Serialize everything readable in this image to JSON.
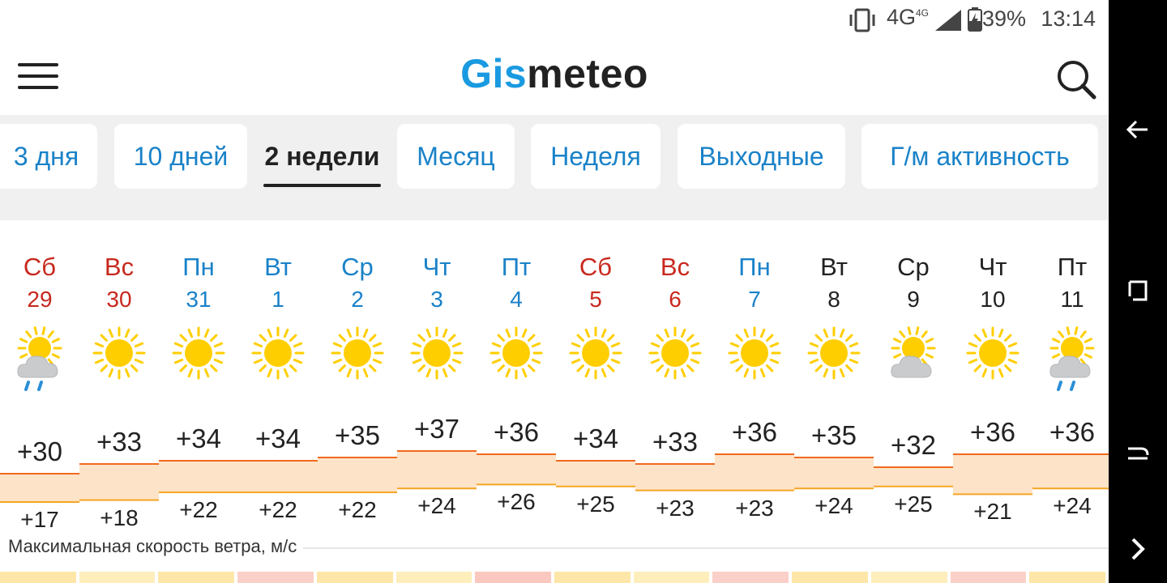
{
  "status": {
    "network": "4G",
    "network_sup": "4G",
    "battery": "39%",
    "time": "13:14"
  },
  "header": {
    "logo_part1": "Gis",
    "logo_part2": "meteo"
  },
  "tabs": [
    {
      "label": "3 дня",
      "active": false
    },
    {
      "label": "10 дней",
      "active": false
    },
    {
      "label": "2 недели",
      "active": true
    },
    {
      "label": "Месяц",
      "active": false
    },
    {
      "label": "Неделя",
      "active": false
    },
    {
      "label": "Выходные",
      "active": false
    },
    {
      "label": "Г/м активность",
      "active": false
    }
  ],
  "days": [
    {
      "dow": "Сб",
      "num": "29",
      "type": "weekend",
      "icon": "partly-cloudy-rain-icon",
      "max": "+30",
      "min": "+17"
    },
    {
      "dow": "Вс",
      "num": "30",
      "type": "weekend",
      "icon": "sun-icon",
      "max": "+33",
      "min": "+18"
    },
    {
      "dow": "Пн",
      "num": "31",
      "type": "weekday",
      "icon": "sun-icon",
      "max": "+34",
      "min": "+22"
    },
    {
      "dow": "Вт",
      "num": "1",
      "type": "weekday",
      "icon": "sun-icon",
      "max": "+34",
      "min": "+22"
    },
    {
      "dow": "Ср",
      "num": "2",
      "type": "weekday",
      "icon": "sun-icon",
      "max": "+35",
      "min": "+22"
    },
    {
      "dow": "Чт",
      "num": "3",
      "type": "weekday",
      "icon": "sun-icon",
      "max": "+37",
      "min": "+24"
    },
    {
      "dow": "Пт",
      "num": "4",
      "type": "weekday",
      "icon": "sun-icon",
      "max": "+36",
      "min": "+26"
    },
    {
      "dow": "Сб",
      "num": "5",
      "type": "weekend",
      "icon": "sun-icon",
      "max": "+34",
      "min": "+25"
    },
    {
      "dow": "Вс",
      "num": "6",
      "type": "weekend",
      "icon": "sun-icon",
      "max": "+33",
      "min": "+23"
    },
    {
      "dow": "Пн",
      "num": "7",
      "type": "weekday",
      "icon": "sun-icon",
      "max": "+36",
      "min": "+23"
    },
    {
      "dow": "Вт",
      "num": "8",
      "type": "normal",
      "icon": "sun-icon",
      "max": "+35",
      "min": "+24"
    },
    {
      "dow": "Ср",
      "num": "9",
      "type": "normal",
      "icon": "partly-cloudy-icon",
      "max": "+32",
      "min": "+25"
    },
    {
      "dow": "Чт",
      "num": "10",
      "type": "normal",
      "icon": "sun-icon",
      "max": "+36",
      "min": "+21"
    },
    {
      "dow": "Пт",
      "num": "11",
      "type": "normal",
      "icon": "partly-cloudy-rain-icon",
      "max": "+36",
      "min": "+24"
    }
  ],
  "wind": {
    "label": "Максимальная скорость ветра, м/с"
  },
  "colors": {
    "accent": "#1a9ae0",
    "weekend": "#c8281e",
    "weekday": "#1a82c8",
    "band_fill": "#fde3c8",
    "max_line": "#f06a1e",
    "min_line": "#f5a623",
    "sun": "#ffce00"
  }
}
